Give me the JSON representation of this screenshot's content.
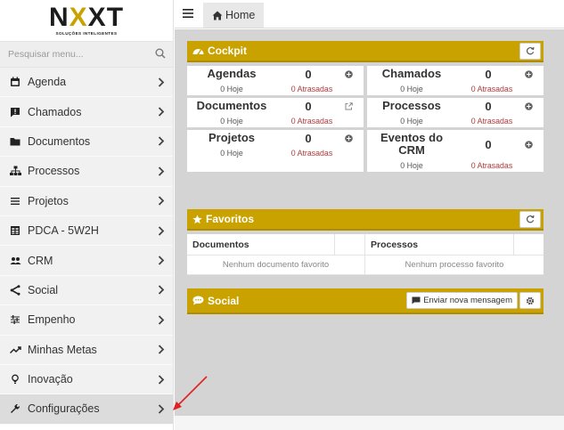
{
  "logo": {
    "text_a": "N",
    "text_x": "X",
    "text_b": "T",
    "tagline": "SOLUÇÕES INTELIGENTES"
  },
  "search": {
    "placeholder": "Pesquisar menu..."
  },
  "sidebar": {
    "items": [
      {
        "label": "Agenda",
        "icon": "calendar-icon"
      },
      {
        "label": "Chamados",
        "icon": "alert-message-icon"
      },
      {
        "label": "Documentos",
        "icon": "folder-icon"
      },
      {
        "label": "Processos",
        "icon": "sitemap-icon"
      },
      {
        "label": "Projetos",
        "icon": "list-icon"
      },
      {
        "label": "PDCA - 5W2H",
        "icon": "table-icon"
      },
      {
        "label": "CRM",
        "icon": "people-icon"
      },
      {
        "label": "Social",
        "icon": "share-icon"
      },
      {
        "label": "Empenho",
        "icon": "tune-icon"
      },
      {
        "label": "Minhas Metas",
        "icon": "trending-up-icon"
      },
      {
        "label": "Inovação",
        "icon": "lightbulb-icon"
      },
      {
        "label": "Configurações",
        "icon": "wrench-icon"
      }
    ]
  },
  "topbar": {
    "home_label": "Home"
  },
  "cockpit": {
    "title": "Cockpit",
    "cards": [
      {
        "name": "Agendas",
        "count": "0",
        "hoje": "0 Hoje",
        "atrasadas": "0 Atrasadas",
        "action": "plus"
      },
      {
        "name": "Chamados",
        "count": "0",
        "hoje": "0 Hoje",
        "atrasadas": "0 Atrasadas",
        "action": "plus"
      },
      {
        "name": "Documentos",
        "count": "0",
        "hoje": "0 Hoje",
        "atrasadas": "0 Atrasadas",
        "action": "external"
      },
      {
        "name": "Processos",
        "count": "0",
        "hoje": "0 Hoje",
        "atrasadas": "0 Atrasadas",
        "action": "plus"
      },
      {
        "name": "Projetos",
        "count": "0",
        "hoje": "0 Hoje",
        "atrasadas": "0 Atrasadas",
        "action": "plus"
      },
      {
        "name": "Eventos do CRM",
        "count": "0",
        "hoje": "0 Hoje",
        "atrasadas": "0 Atrasadas",
        "action": "plus"
      }
    ]
  },
  "favoritos": {
    "title": "Favoritos",
    "col_documentos": "Documentos",
    "col_processos": "Processos",
    "empty_documentos": "Nenhum documento favorito",
    "empty_processos": "Nenhum processo favorito"
  },
  "social": {
    "title": "Social",
    "send_label": "Enviar nova mensagem"
  },
  "colors": {
    "brand_gold": "#c9a200",
    "danger_text": "#b03a3a",
    "annotation_arrow": "#e02020"
  }
}
